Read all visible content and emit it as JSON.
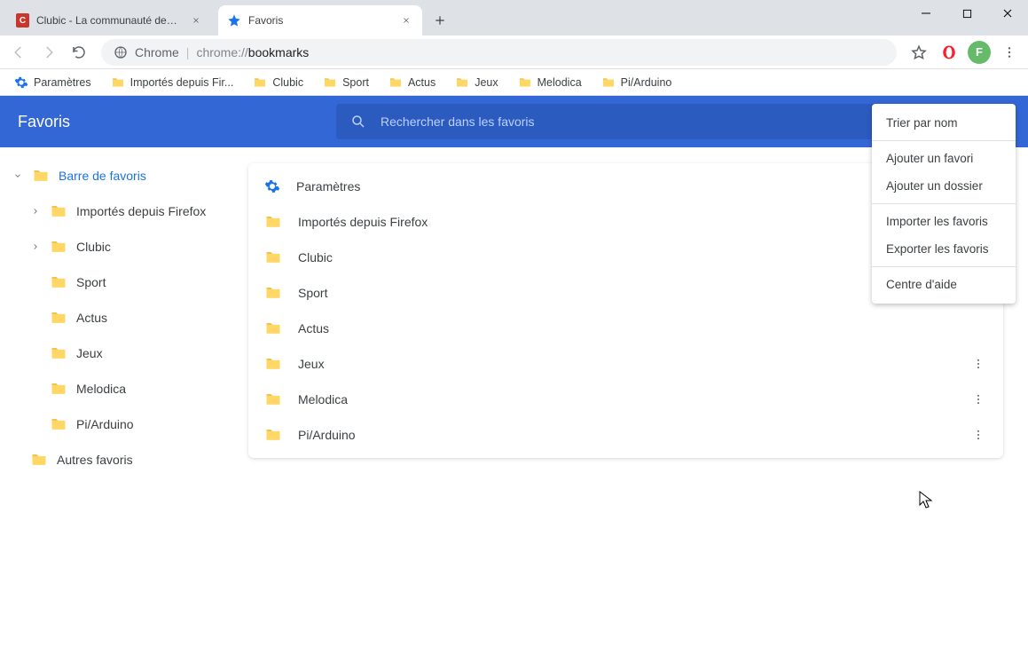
{
  "tabs": [
    {
      "title": "Clubic - La communauté des pas",
      "favicon": "clubic"
    },
    {
      "title": "Favoris",
      "favicon": "star"
    }
  ],
  "omnibox": {
    "prefix": "Chrome",
    "url": "chrome://bookmarks",
    "url_gray": "chrome://",
    "url_dark": "bookmarks"
  },
  "avatar_initial": "F",
  "bookmarks_bar": [
    {
      "label": "Paramètres",
      "icon": "gear"
    },
    {
      "label": "Importés depuis Fir...",
      "icon": "folder"
    },
    {
      "label": "Clubic",
      "icon": "folder"
    },
    {
      "label": "Sport",
      "icon": "folder"
    },
    {
      "label": "Actus",
      "icon": "folder"
    },
    {
      "label": "Jeux",
      "icon": "folder"
    },
    {
      "label": "Melodica",
      "icon": "folder"
    },
    {
      "label": "Pi/Arduino",
      "icon": "folder"
    }
  ],
  "app": {
    "title": "Favoris",
    "search_placeholder": "Rechercher dans les favoris"
  },
  "sidebar": {
    "root": "Barre de favoris",
    "items": [
      {
        "label": "Importés depuis Firefox",
        "expandable": true
      },
      {
        "label": "Clubic",
        "expandable": true
      },
      {
        "label": "Sport",
        "expandable": false
      },
      {
        "label": "Actus",
        "expandable": false
      },
      {
        "label": "Jeux",
        "expandable": false
      },
      {
        "label": "Melodica",
        "expandable": false
      },
      {
        "label": "Pi/Arduino",
        "expandable": false
      }
    ],
    "other": "Autres favoris"
  },
  "list": [
    {
      "label": "Paramètres",
      "icon": "gear",
      "more": false
    },
    {
      "label": "Importés depuis Firefox",
      "icon": "folder",
      "more": false
    },
    {
      "label": "Clubic",
      "icon": "folder",
      "more": false
    },
    {
      "label": "Sport",
      "icon": "folder",
      "more": false
    },
    {
      "label": "Actus",
      "icon": "folder",
      "more": false
    },
    {
      "label": "Jeux",
      "icon": "folder",
      "more": true
    },
    {
      "label": "Melodica",
      "icon": "folder",
      "more": true
    },
    {
      "label": "Pi/Arduino",
      "icon": "folder",
      "more": true
    }
  ],
  "menu": [
    {
      "label": "Trier par nom"
    },
    {
      "sep": true
    },
    {
      "label": "Ajouter un favori"
    },
    {
      "label": "Ajouter un dossier"
    },
    {
      "sep": true
    },
    {
      "label": "Importer les favoris"
    },
    {
      "label": "Exporter les favoris"
    },
    {
      "sep": true
    },
    {
      "label": "Centre d'aide"
    }
  ]
}
